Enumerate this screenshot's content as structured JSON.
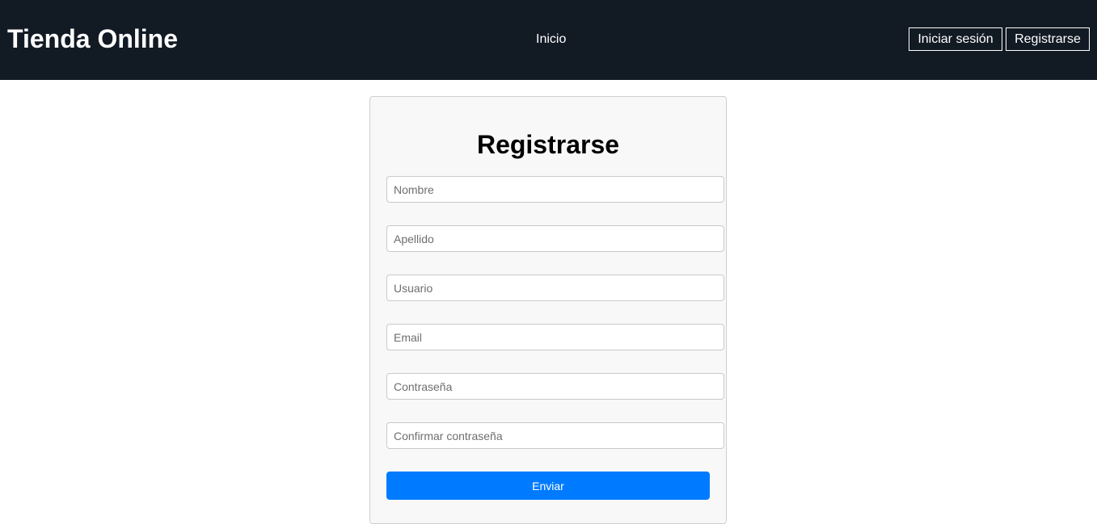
{
  "header": {
    "brand": "Tienda Online",
    "nav": {
      "home_label": "Inicio"
    },
    "auth": {
      "login_label": "Iniciar sesión",
      "register_label": "Registrarse"
    }
  },
  "form": {
    "title": "Registrarse",
    "fields": [
      {
        "placeholder": "Nombre",
        "value": ""
      },
      {
        "placeholder": "Apellido",
        "value": ""
      },
      {
        "placeholder": "Usuario",
        "value": ""
      },
      {
        "placeholder": "Email",
        "value": ""
      },
      {
        "placeholder": "Contraseña",
        "value": ""
      },
      {
        "placeholder": "Confirmar contraseña",
        "value": ""
      }
    ],
    "submit_label": "Enviar"
  },
  "colors": {
    "header_bg": "#121a24",
    "card_bg": "#f8f8f8",
    "primary": "#007bff"
  }
}
